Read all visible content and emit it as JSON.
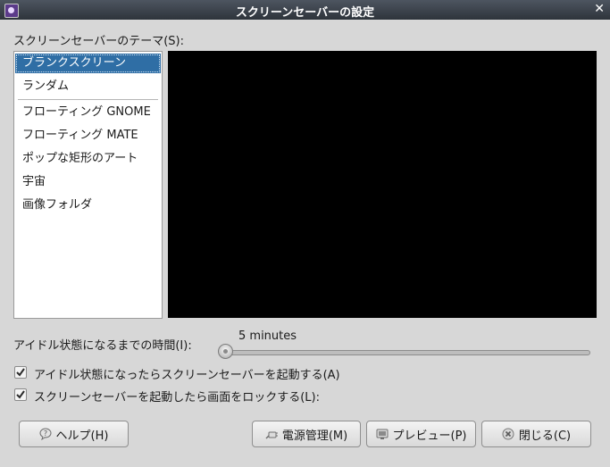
{
  "window": {
    "title": "スクリーンセーバーの設定"
  },
  "theme": {
    "label": "スクリーンセーバーのテーマ(S):",
    "items": [
      "ブランクスクリーン",
      "ランダム",
      "フローティング GNOME",
      "フローティング MATE",
      "ポップな矩形のアート",
      "宇宙",
      "画像フォルダ"
    ],
    "selected": "ブランクスクリーン"
  },
  "idle": {
    "label": "アイドル状態になるまでの時間(I):",
    "value": "5 minutes"
  },
  "options": {
    "activate_label": "アイドル状態になったらスクリーンセーバーを起動する(A)",
    "activate_checked": true,
    "lock_label": "スクリーンセーバーを起動したら画面をロックする(L):",
    "lock_checked": true
  },
  "buttons": {
    "help": "ヘルプ(H)",
    "power": "電源管理(M)",
    "preview": "プレビュー(P)",
    "close": "閉じる(C)"
  },
  "icons": {
    "app": "screensaver-app-icon",
    "close": "close-icon",
    "help": "help-icon",
    "power": "power-plug-icon",
    "preview": "preview-icon",
    "close_button": "close-x-icon"
  },
  "colors": {
    "selection": "#2f6ea5",
    "preview_bg": "#000000",
    "titlebar": "#3a4048"
  }
}
